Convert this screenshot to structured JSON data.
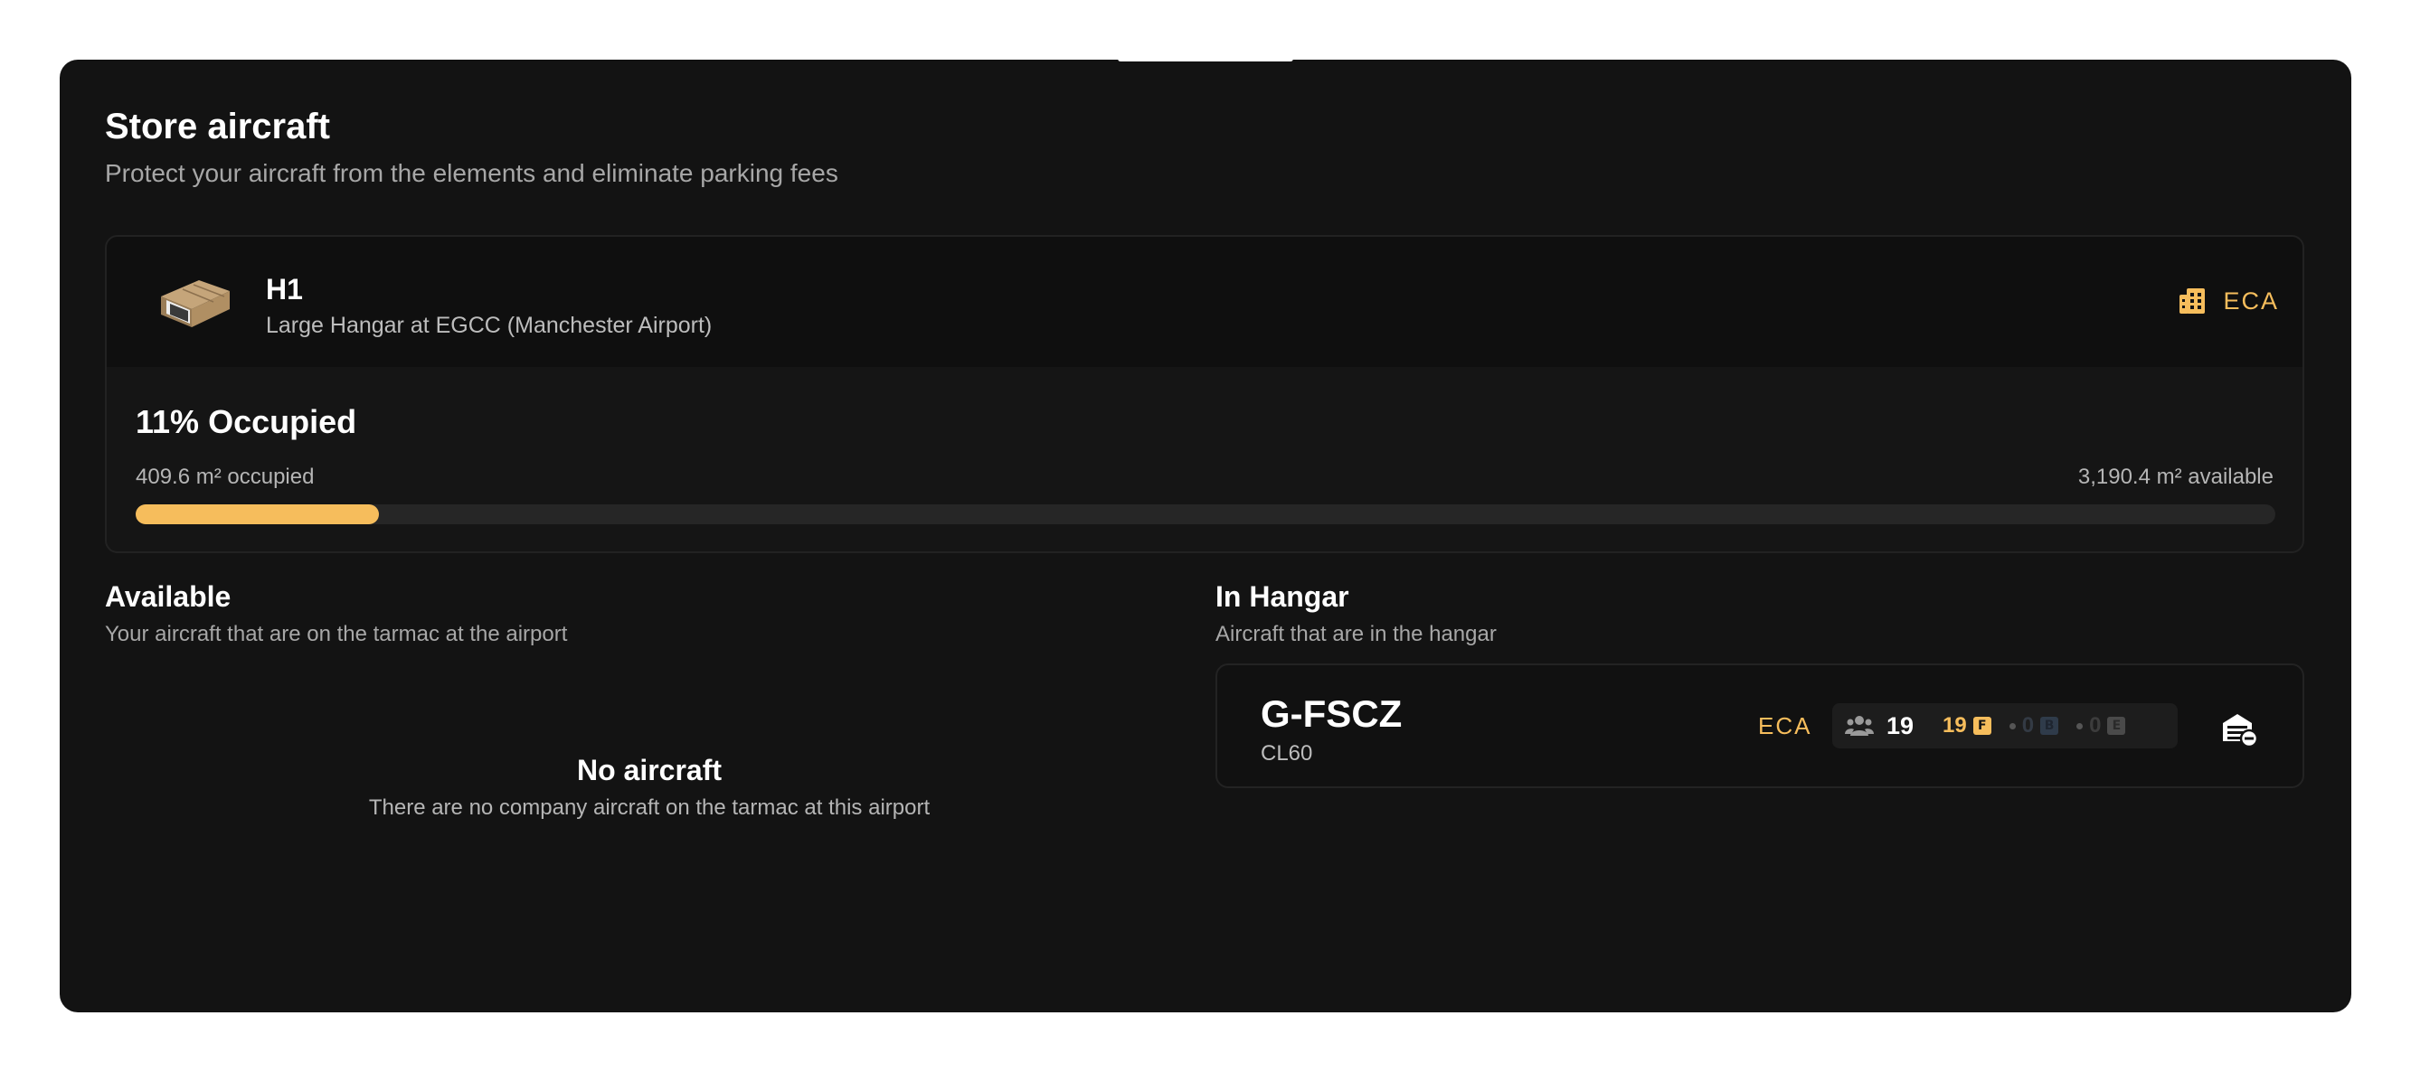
{
  "modal": {
    "title": "Store aircraft",
    "subtitle": "Protect your aircraft from the elements and eliminate parking fees"
  },
  "hangar": {
    "image_icon": "hangar-box-icon",
    "name": "H1",
    "description": "Large Hangar at EGCC (Manchester Airport)",
    "owner_icon": "building-icon",
    "owner_code": "ECA",
    "occupancy_title": "11% Occupied",
    "occupancy_percent": 11.35,
    "occupied_text": "409.6 m² occupied",
    "available_text": "3,190.4 m² available"
  },
  "available": {
    "title": "Available",
    "subtitle": "Your aircraft that are on the tarmac at the airport",
    "empty_title": "No aircraft",
    "empty_subtitle": "There are no company aircraft on the tarmac at this airport"
  },
  "in_hangar": {
    "title": "In Hangar",
    "subtitle": "Aircraft that are in the hangar",
    "aircraft": [
      {
        "registration": "G-FSCZ",
        "type": "CL60",
        "owner": "ECA",
        "passenger_icon": "passengers-icon",
        "total_seats": "19",
        "classes": [
          {
            "label": "F",
            "value": "19",
            "color": "#f6bd5c"
          },
          {
            "label": "B",
            "value": "0",
            "color": "#2f3b4a"
          },
          {
            "label": "E",
            "value": "0",
            "color": "#4a4a4a"
          }
        ],
        "action_icon": "remove-from-hangar-icon"
      }
    ]
  },
  "colors": {
    "accent": "#f6bd5c",
    "background": "#131313",
    "card": "#0f0f0f"
  }
}
